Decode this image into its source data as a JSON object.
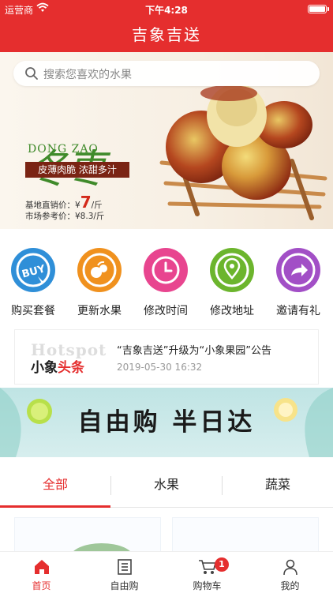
{
  "status_bar": {
    "carrier": "运营商",
    "time": "下午4:28"
  },
  "header": {
    "title": "吉象吉送"
  },
  "search": {
    "placeholder": "搜索您喜欢的水果"
  },
  "banner": {
    "brand": "冬枣",
    "pinyin": "DONG ZAO",
    "slogan": "皮薄肉脆 浓甜多汁",
    "base_price_label": "基地直销价：¥",
    "base_price_value": "7",
    "base_price_unit": "/斤",
    "market_price": "市场参考价：¥8.3/斤"
  },
  "quick_actions": [
    {
      "label": "购买套餐",
      "icon": "buy-icon",
      "color": "#2f8fd8"
    },
    {
      "label": "更新水果",
      "icon": "fruit-icon",
      "color": "#f0911e"
    },
    {
      "label": "修改时间",
      "icon": "clock-icon",
      "color": "#e8458f"
    },
    {
      "label": "修改地址",
      "icon": "location-icon",
      "color": "#6cb52d"
    },
    {
      "label": "邀请有礼",
      "icon": "share-icon",
      "color": "#a24fc6"
    }
  ],
  "notice": {
    "logo_ghost": "Hotspot",
    "logo_black": "小象",
    "logo_red": "头条",
    "title": "“吉象吉送”升级为“小象果园”公告",
    "date": "2019-05-30 16:32"
  },
  "promo": {
    "text": "自由购  半日达"
  },
  "category_tabs": [
    {
      "label": "全部",
      "active": true
    },
    {
      "label": "水果",
      "active": false
    },
    {
      "label": "蔬菜",
      "active": false
    }
  ],
  "tabbar": [
    {
      "label": "首页",
      "icon": "home-icon",
      "active": true
    },
    {
      "label": "自由购",
      "icon": "list-icon",
      "active": false
    },
    {
      "label": "购物车",
      "icon": "cart-icon",
      "active": false,
      "badge": "1"
    },
    {
      "label": "我的",
      "icon": "user-icon",
      "active": false
    }
  ],
  "colors": {
    "primary": "#e52e2e",
    "brand_green": "#3f8a2a"
  }
}
